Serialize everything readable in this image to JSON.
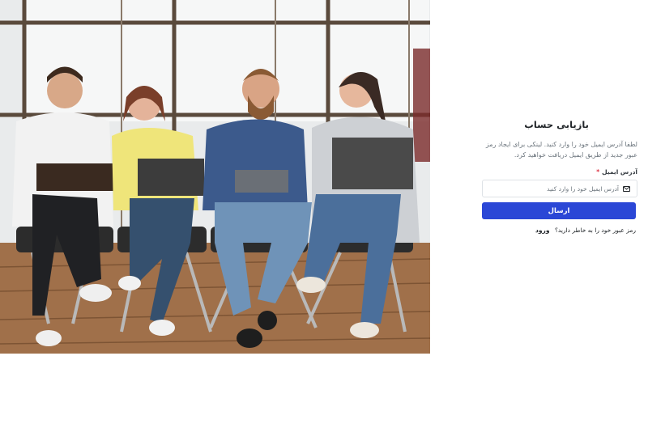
{
  "hero": {
    "description": "photo-four-people-sitting-with-laptops-books-and-tablet"
  },
  "form": {
    "title": "بازیابی حساب",
    "description": "لطفا آدرس ایمیل خود را وارد کنید. لینکی برای ایجاد رمز عبور جدید از طریق ایمیل دریافت خواهید کرد.",
    "email_label": "آدرس ایمیل",
    "required_mark": "*",
    "email_placeholder": "آدرس ایمیل خود را وارد کنید",
    "email_value": "",
    "email_icon": "envelope-icon",
    "submit_label": "ارسال",
    "footer_text": "رمز عبور خود را به خاطر دارید؟",
    "login_link": "ورود"
  },
  "colors": {
    "primary": "#2b47d6",
    "required": "#dc3545",
    "text": "#212529",
    "muted": "#6c757d"
  }
}
